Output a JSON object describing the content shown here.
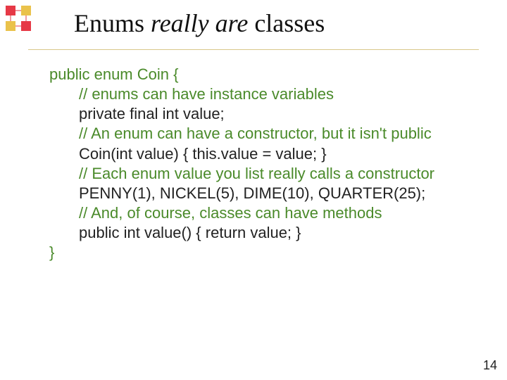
{
  "title": {
    "part1": "Enums ",
    "part2": "really are",
    "part3": " classes"
  },
  "code": {
    "l1": "public enum Coin {",
    "l2": "// enums can have instance variables",
    "l3": "private final int value;",
    "l4": "// An enum can have a constructor, but it isn't public",
    "l5": "Coin(int value) { this.value = value; }",
    "l6": "// Each enum value you list really calls a constructor",
    "l7": "PENNY(1), NICKEL(5), DIME(10), QUARTER(25);",
    "l8": "// And, of course, classes can have methods",
    "l9": "public int value() { return value; }",
    "l10": "}"
  },
  "slide_number": "14"
}
